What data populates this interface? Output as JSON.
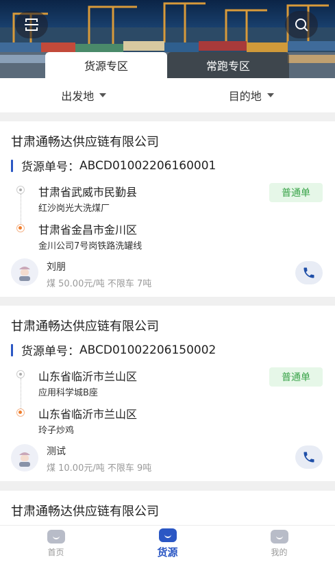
{
  "header": {
    "tabs": [
      {
        "label": "货源专区",
        "active": true
      },
      {
        "label": "常跑专区",
        "active": false
      }
    ],
    "scan_icon": "scan-icon",
    "search_icon": "search-icon"
  },
  "filter": {
    "origin_label": "出发地",
    "destination_label": "目的地"
  },
  "cards": [
    {
      "company": "甘肃通畅达供应链有限公司",
      "order_label": "货源单号：",
      "order_no": "ABCD01002206160001",
      "from_city": "甘肃省武威市民勤县",
      "from_addr": "红沙岗光大洗煤厂",
      "to_city": "甘肃省金昌市金川区",
      "to_addr": "金川公司7号岗铁路洗罐线",
      "badge": "普通单",
      "driver": "刘朋",
      "price_info": "煤 50.00元/吨 不限车 7吨"
    },
    {
      "company": "甘肃通畅达供应链有限公司",
      "order_label": "货源单号：",
      "order_no": "ABCD01002206150002",
      "from_city": "山东省临沂市兰山区",
      "from_addr": "应用科学城B座",
      "to_city": "山东省临沂市兰山区",
      "to_addr": "玲子炒鸡",
      "badge": "普通单",
      "driver": "测试",
      "price_info": "煤 10.00元/吨 不限车 9吨"
    },
    {
      "company": "甘肃通畅达供应链有限公司"
    }
  ],
  "bottom_nav": [
    {
      "label": "首页",
      "active": false
    },
    {
      "label": "货源",
      "active": true
    },
    {
      "label": "我的",
      "active": false
    }
  ],
  "colors": {
    "accent": "#2b57c4",
    "badge_bg": "#e6f7e8",
    "badge_text": "#3aa44a",
    "end_dot": "#ef7d2b"
  }
}
